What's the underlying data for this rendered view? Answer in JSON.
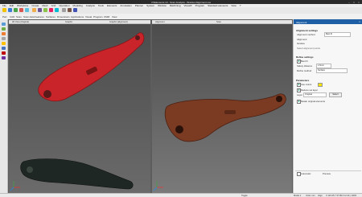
{
  "app": {
    "title": "VXElements 10 - Scan Analysis - Bracket Alignment.vxe"
  },
  "menu": [
    "File",
    "Edit",
    "Workplane",
    "Create",
    "Mesh",
    "Grid",
    "Operation",
    "Modeling",
    "Analysis",
    "Tools",
    "Elements",
    "Annotation",
    "Planner",
    "System",
    "Window",
    "Machining",
    "VisualX",
    "Program",
    "Standard elements",
    "View",
    "?"
  ],
  "tabs": [
    "Part",
    "CAD",
    "Scan",
    "Scan data",
    "Features",
    "Surfaces",
    "Dimensions",
    "Applications",
    "Visual",
    "Program",
    "CMM",
    "View"
  ],
  "left_pane": {
    "header": "3D View (Original)",
    "section_a": "Graphic",
    "section_b": "Graphic (alignment)"
  },
  "right_pane": {
    "header": "Alignment",
    "section": "Scan"
  },
  "right_panel": {
    "title": "Alignment",
    "alignment_settings": "Alignment settings",
    "alignment_method_label": "Alignment method",
    "alignment_method_value": "Best fit",
    "option_1": "Alignment",
    "option_2": "Iterative",
    "hint": "Select alignment points",
    "refine_settings": "Refine settings",
    "best_fit_label": "Best fit",
    "safety_distance_label": "Safety distance",
    "safety_distance_value": "1.5mm",
    "refine_method_label": "Refine method",
    "refine_method_value": "Surface",
    "parameters": "Parameters",
    "use_colors_label": "Use colors",
    "reduce_set_label": "Reduce set layer",
    "layer_label": "Layer",
    "layer_value": "Original",
    "select_button": "Select",
    "retain_label": "Retain original elements",
    "bottom_tab_1": "Automatic",
    "bottom_tab_2": "Preview"
  },
  "status": {
    "left": "Toggle",
    "mid1": "Model 1",
    "mid2": "Units: mm",
    "mid3": "Align",
    "right": "X 123.45  Y 67.89  Z 12.34  |  100%"
  },
  "colors": {
    "part_red": "#c8242a",
    "part_rust": "#7b3a22",
    "part_dark": "#1e2622",
    "accent": "#1e5fa6"
  }
}
